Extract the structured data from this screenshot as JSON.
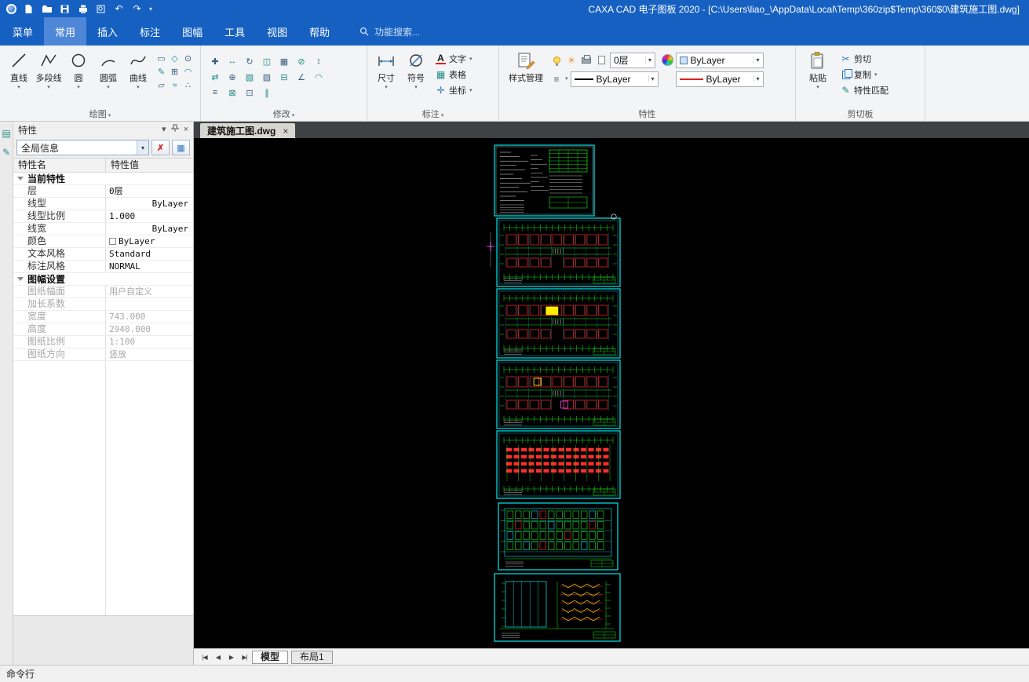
{
  "titlebar": {
    "title": "CAXA CAD 电子图板 2020 - [C:\\Users\\liao_\\AppData\\Local\\Temp\\360zip$Temp\\360$0\\建筑施工图.dwg]"
  },
  "menubar": {
    "tabs": [
      "菜单",
      "常用",
      "插入",
      "标注",
      "图幅",
      "工具",
      "视图",
      "帮助"
    ],
    "active_tab": "常用",
    "search_text": "功能搜索..."
  },
  "ribbon": {
    "draw": {
      "label": "绘图",
      "tools": [
        {
          "label": "直线"
        },
        {
          "label": "多段线"
        },
        {
          "label": "圆"
        },
        {
          "label": "圆弧"
        },
        {
          "label": "曲线"
        }
      ]
    },
    "modify": {
      "label": "修改"
    },
    "annotate": {
      "label": "标注",
      "dim": "尺寸",
      "symbol": "符号",
      "text": "文字",
      "table": "表格",
      "coord": "坐标"
    },
    "props": {
      "label": "特性",
      "style_manager": "样式管理",
      "layer": "0层",
      "color": "ByLayer",
      "linetype": "ByLayer",
      "lineweight": "ByLayer"
    },
    "clipboard": {
      "label": "剪切板",
      "paste": "粘贴",
      "cut": "剪切",
      "copy": "复制",
      "match": "特性匹配"
    }
  },
  "props_panel": {
    "title": "特性",
    "scope": "全局信息",
    "col_name": "特性名",
    "col_value": "特性值",
    "sections": [
      {
        "header": "当前特性",
        "rows": [
          {
            "name": "层",
            "value": "0层"
          },
          {
            "name": "线型",
            "value": "ByLayer"
          },
          {
            "name": "线型比例",
            "value": "1.000"
          },
          {
            "name": "线宽",
            "value": "ByLayer"
          },
          {
            "name": "颜色",
            "value": "ByLayer"
          },
          {
            "name": "文本风格",
            "value": "Standard"
          },
          {
            "name": "标注风格",
            "value": "NORMAL"
          }
        ]
      },
      {
        "header": "图幅设置",
        "rows": [
          {
            "name": "图纸幅面",
            "value": "用户自定义"
          },
          {
            "name": "加长系数",
            "value": ""
          },
          {
            "name": "宽度",
            "value": "743.000"
          },
          {
            "name": "高度",
            "value": "2940.000"
          },
          {
            "name": "图纸比例",
            "value": "1:100"
          },
          {
            "name": "图纸方向",
            "value": "竖放"
          }
        ]
      }
    ]
  },
  "document_tab": {
    "label": "建筑施工图.dwg"
  },
  "canvas": {
    "sheets": 7
  },
  "model_bar": {
    "tabs": [
      "模型",
      "布局1"
    ],
    "active_tab": "模型"
  },
  "command_bar": {
    "label": "命令行"
  }
}
